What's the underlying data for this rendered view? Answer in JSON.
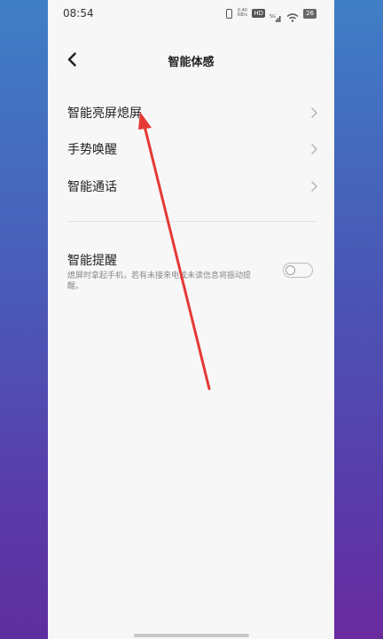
{
  "status_bar": {
    "time": "08:54",
    "speed": "0.40 KB/s",
    "hd_badge": "HD",
    "signal": "5G",
    "battery": "26"
  },
  "header": {
    "title": "智能体感"
  },
  "menu": {
    "items": [
      {
        "label": "智能亮屏熄屏"
      },
      {
        "label": "手势唤醒"
      },
      {
        "label": "智能通话"
      }
    ]
  },
  "smart_reminder": {
    "title": "智能提醒",
    "description": "熄屏时拿起手机，若有未接来电或未读信息将振动提醒。",
    "enabled": false
  },
  "colors": {
    "annotation_arrow": "#e53935",
    "background_gradient_top": "#3f7fc6",
    "background_gradient_bottom": "#6a2aa0"
  }
}
